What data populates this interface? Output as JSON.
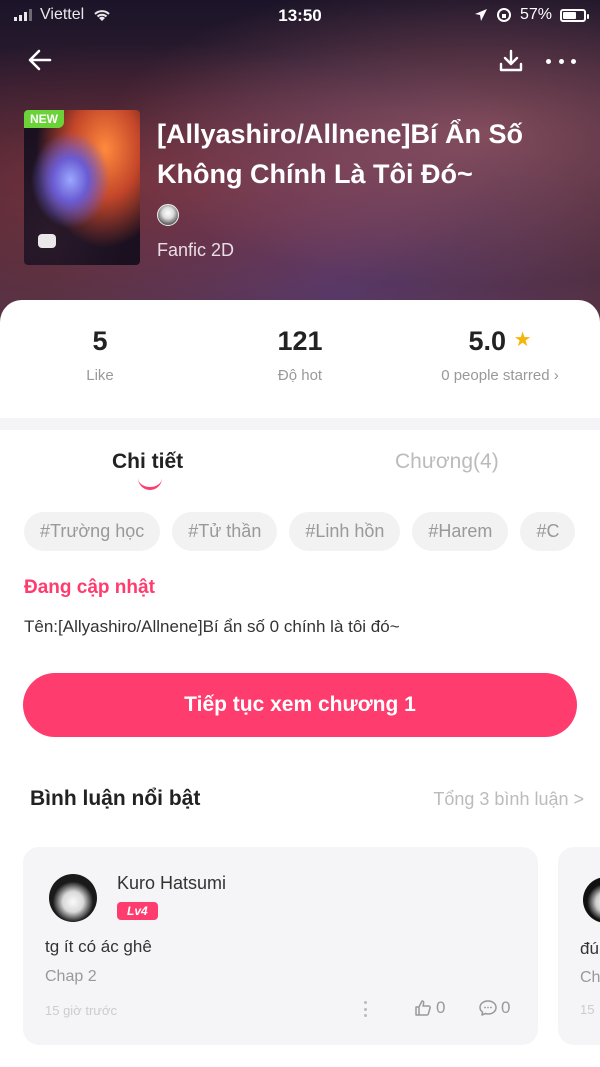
{
  "status_bar": {
    "carrier": "Viettel",
    "time": "13:50",
    "battery": "57%"
  },
  "book": {
    "badge": "NEW",
    "title_line1": "[Allyashiro/Allnene]Bí Ẩn Số",
    "title_line2": "Không Chính Là Tôi Đó~",
    "genre": "Fanfic 2D"
  },
  "stats": {
    "likes": {
      "value": "5",
      "label": "Like"
    },
    "hot": {
      "value": "121",
      "label": "Độ hot"
    },
    "rating": {
      "value": "5.0",
      "label": "0 people starred",
      "chevron": "›"
    }
  },
  "tabs": {
    "details": "Chi tiết",
    "chapters": "Chương(4)"
  },
  "tags": [
    "#Trường học",
    "#Tử thần",
    "#Linh hồn",
    "#Harem",
    "#C"
  ],
  "update_status": "Đang cập nhật",
  "description": "Tên:[Allyashiro/Allnene]Bí ẩn số 0 chính là tôi đó~",
  "continue_button": "Tiếp tục xem chương 1",
  "comments_section": {
    "title": "Bình luận nổi bật",
    "total_link": "Tổng 3 bình luận >",
    "comments": [
      {
        "user": "Kuro Hatsumi",
        "level": "Lv4",
        "text": "tg ít có ác ghê",
        "chapter": "Chap 2",
        "time": "15 giờ trước",
        "likes": "0",
        "replies": "0"
      },
      {
        "text_partial": "đú",
        "chapter_partial": "Ch",
        "time_partial": "15"
      }
    ]
  },
  "colors": {
    "accent": "#ff3c6e",
    "star": "#f5b50a",
    "new_badge": "#6bd23a"
  }
}
